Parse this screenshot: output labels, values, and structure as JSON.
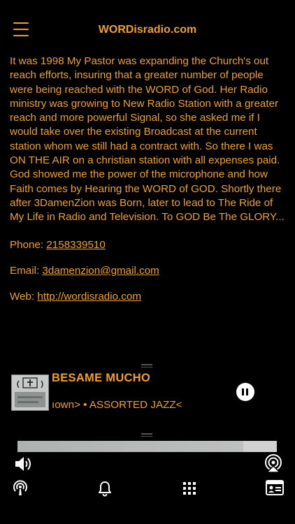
{
  "header": {
    "title": "WORDisradio.com",
    "menu_icon": "hamburger-menu-icon"
  },
  "content": {
    "bio": "It was 1998 My Pastor was expanding the Church's out reach efforts, insuring that a greater number of people were being reached with the WORD of God. Her Radio ministry was growing to New Radio Station with a greater reach and more powerful Signal, so she asked me if I would take over the existing Broadcast at the current station whom we still had a contract with. So there I was ON THE AIR on a christian station with all expenses paid. God showed me the power of the microphone and how Faith comes by Hearing the WORD of GOD. Shortly there after 3DamenZion was Born, later to lead to The Ride of My Life in Radio and Television. To GOD Be The GLORY...",
    "phone_label": "Phone: ",
    "phone_value": "2158339510",
    "email_label": "Email: ",
    "email_value": "3damenzion@gmail.com",
    "web_label": "Web: ",
    "web_value": "http://wordisradio.com"
  },
  "player": {
    "track_title": "BESAME MUCHO",
    "track_subtitle": "ıown> • ASSORTED JAZZ<",
    "playback_state": "playing",
    "progress_fraction": 0.87
  },
  "bottom_bar": {
    "icons": [
      "volume-icon",
      "airplay-icon",
      "podcast-icon",
      "bell-icon",
      "grid-icon",
      "contact-card-icon"
    ]
  },
  "colors": {
    "accent": "#f0a028",
    "background": "#000000",
    "icon": "#ffffff"
  }
}
